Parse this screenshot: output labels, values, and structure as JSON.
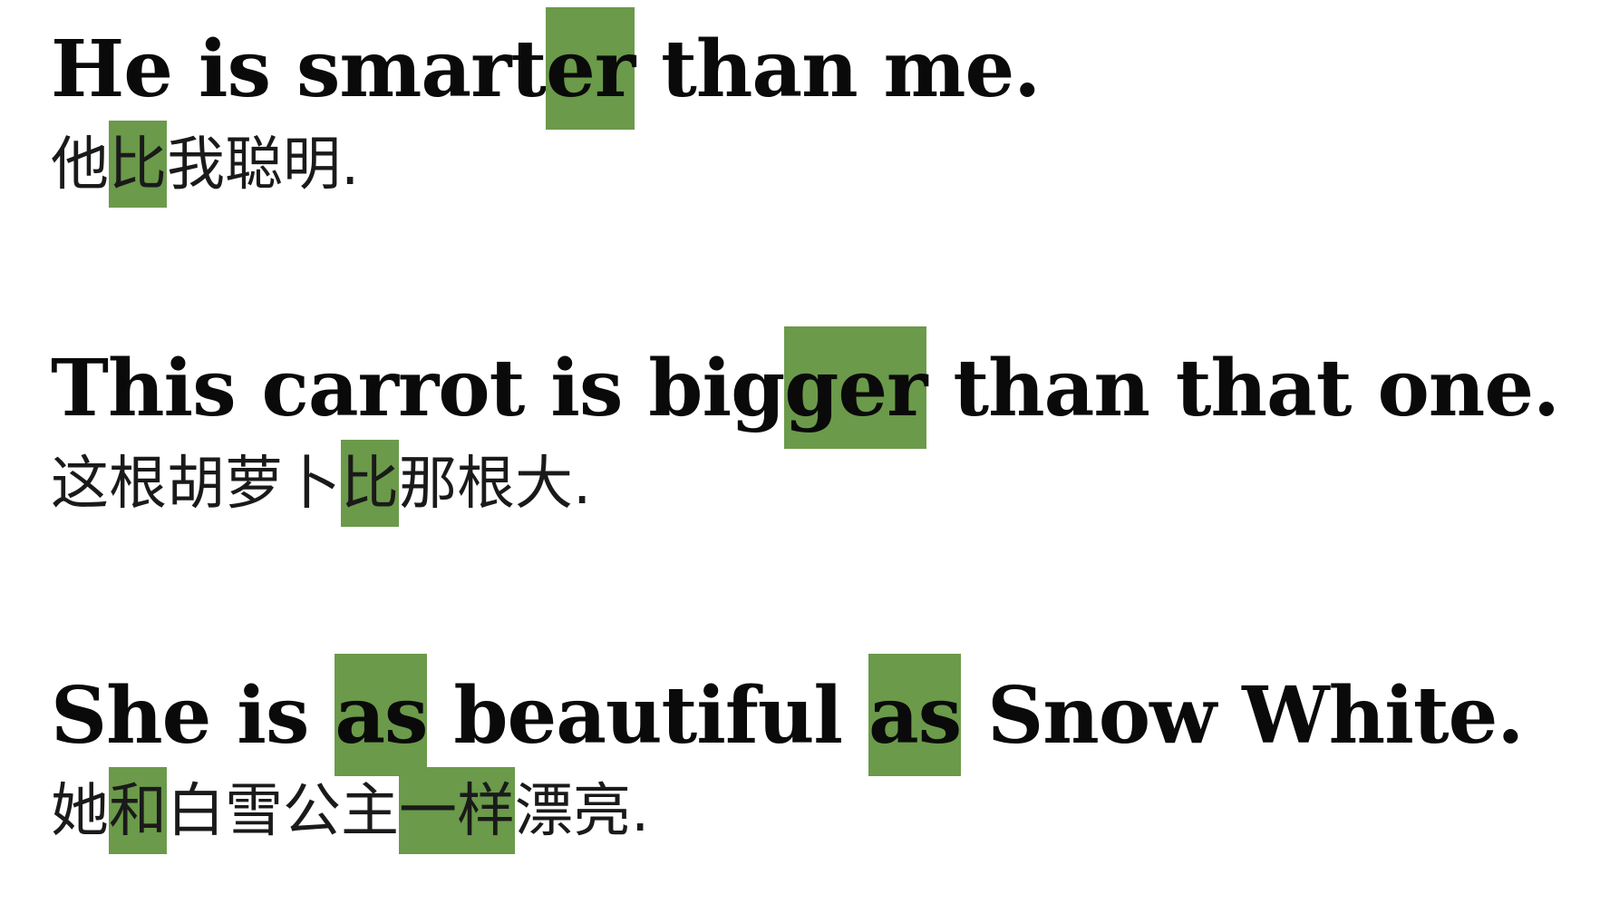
{
  "sentences": [
    {
      "english": [
        "He is smart",
        "er",
        " than me."
      ],
      "chinese": [
        "他",
        "比",
        "我聪明."
      ]
    },
    {
      "english": [
        "This carrot is big",
        "ger",
        " than that one."
      ],
      "chinese": [
        "这根胡萝卜",
        "比",
        "那根大."
      ]
    },
    {
      "english": [
        "She is ",
        "as",
        " beautiful ",
        "as",
        " Snow White."
      ],
      "chinese": [
        "她",
        "和",
        "白雪公主",
        "一样",
        "漂亮."
      ]
    }
  ],
  "colors": {
    "highlight": "#6b9a4a",
    "text": "#0a0a0a",
    "background": "#ffffff"
  }
}
